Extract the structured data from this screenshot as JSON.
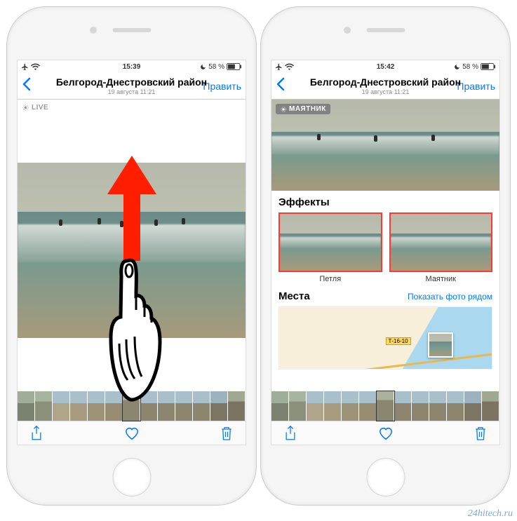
{
  "watermark": "24hitech.ru",
  "left": {
    "status": {
      "time": "15:39",
      "battery": "58 %"
    },
    "nav": {
      "title": "Белгород-Днестровский район",
      "subtitle": "19 августа 11:21",
      "edit": "Править"
    },
    "live_chip": "LIVE"
  },
  "right": {
    "status": {
      "time": "15:42",
      "battery": "58 %"
    },
    "nav": {
      "title": "Белгород-Днестровский район",
      "subtitle": "19 августа 11:21",
      "edit": "Править"
    },
    "live_chip": "МАЯТНИК",
    "effects_heading": "Эффекты",
    "effects": [
      {
        "label": "Петля"
      },
      {
        "label": "Маятник"
      }
    ],
    "places_heading": "Места",
    "places_link": "Показать фото рядом",
    "road_label": "Т-16-10"
  }
}
